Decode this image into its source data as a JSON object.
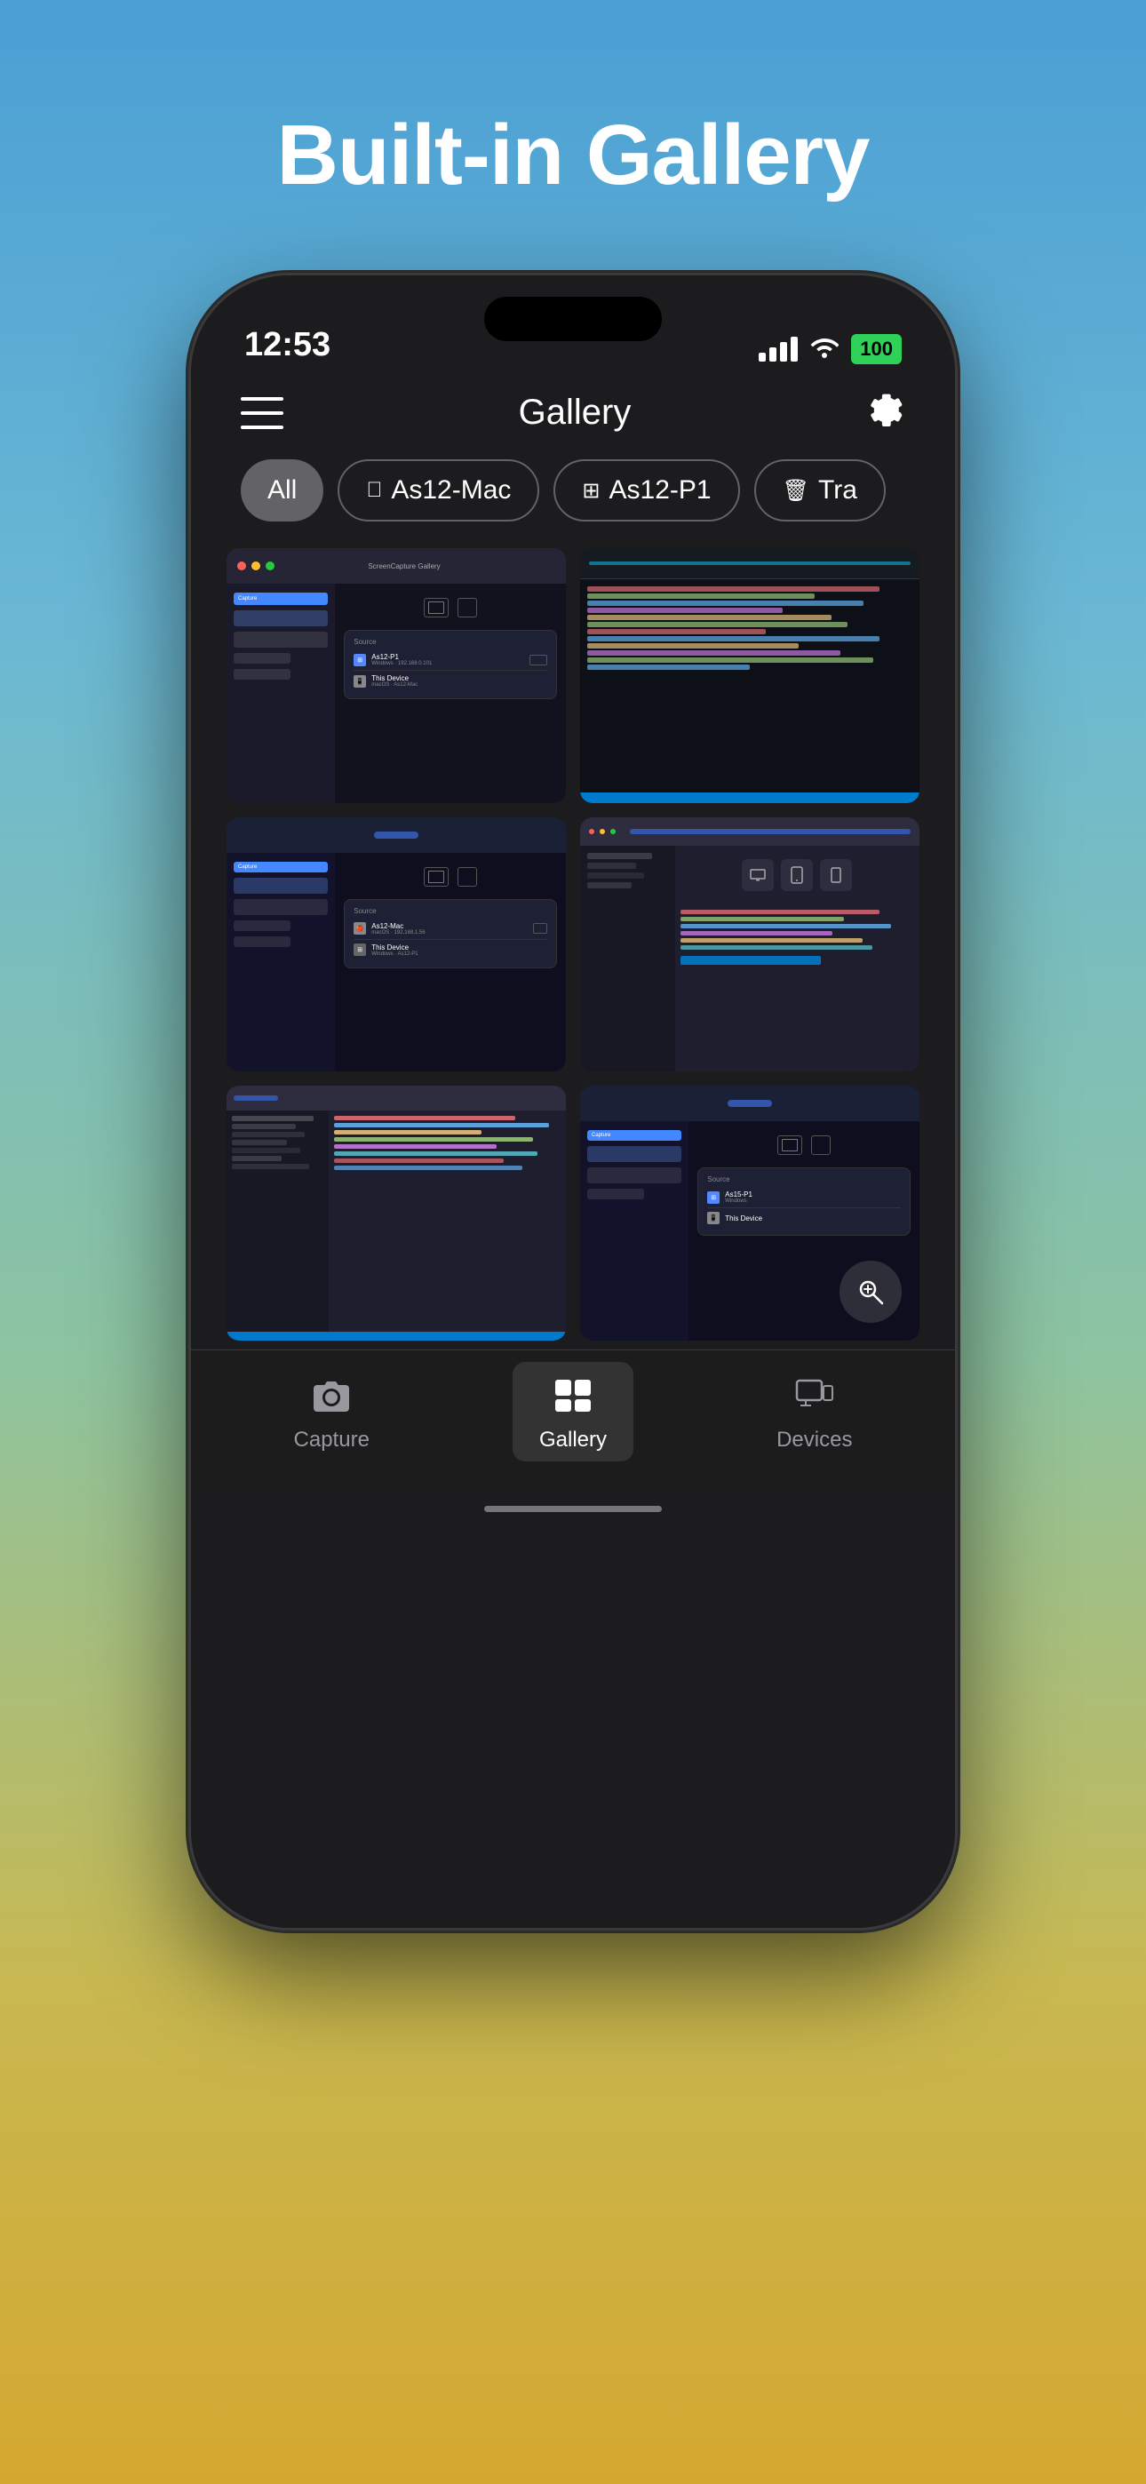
{
  "page": {
    "title": "Built-in Gallery",
    "background": "linear-gradient blue-yellow"
  },
  "status_bar": {
    "time": "12:53",
    "battery": "100",
    "battery_color": "#30d158"
  },
  "nav": {
    "title": "Gallery",
    "menu_icon": "≡",
    "settings_icon": "⚙"
  },
  "filter_tabs": [
    {
      "label": "All",
      "active": true,
      "icon": ""
    },
    {
      "label": "As12-Mac",
      "active": false,
      "icon": ""
    },
    {
      "label": "As12-P1",
      "active": false,
      "icon": "⊞"
    },
    {
      "label": "Tra",
      "active": false,
      "icon": "🗑"
    }
  ],
  "gallery": {
    "items": [
      {
        "id": 1,
        "type": "capture-app",
        "col": 1
      },
      {
        "id": 2,
        "type": "code-dark",
        "col": 2
      },
      {
        "id": 3,
        "type": "capture-app-2",
        "col": 1
      },
      {
        "id": 4,
        "type": "ide-dark",
        "col": 2
      },
      {
        "id": 5,
        "type": "code-vscode",
        "col": 1
      },
      {
        "id": 6,
        "type": "capture-overlay",
        "col": 2
      }
    ]
  },
  "tab_bar": {
    "items": [
      {
        "label": "Capture",
        "active": false,
        "icon": "camera"
      },
      {
        "label": "Gallery",
        "active": true,
        "icon": "photo"
      },
      {
        "label": "Devices",
        "active": false,
        "icon": "display"
      }
    ]
  }
}
